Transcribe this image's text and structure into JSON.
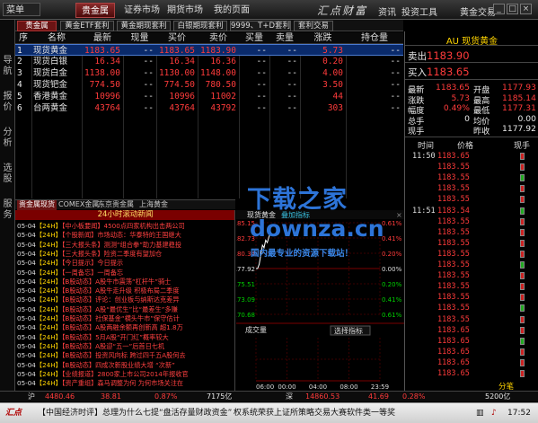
{
  "topbar": {
    "menu_label": "菜单",
    "tabs": [
      "贵金属",
      "证券市场",
      "期货市场",
      "我的页面"
    ],
    "logo": "汇点财富",
    "right_items": [
      "资讯",
      "投资工具",
      "黄金交易"
    ],
    "window_buttons": [
      "_",
      "□",
      "×"
    ]
  },
  "sidebar": {
    "items": [
      "导航",
      "报价",
      "分析",
      "选股",
      "服务"
    ]
  },
  "subtabs": [
    "贵金属",
    "黄金ETF套利",
    "黄金期现套利",
    "白银期现套利",
    "9999、T+D套利",
    "套利交易"
  ],
  "quote_table": {
    "columns": [
      "序",
      "名称",
      "最新",
      "现量",
      "买价",
      "卖价",
      "买量",
      "卖量",
      "涨跌",
      "持仓量"
    ],
    "rows": [
      {
        "idx": "1",
        "name": "现货黄金",
        "last": "1183.65",
        "vol": "--",
        "bid": "1183.65",
        "ask": "1183.90",
        "bidvol": "--",
        "askvol": "--",
        "chg": "5.73",
        "oi": "--"
      },
      {
        "idx": "2",
        "name": "现货白银",
        "last": "16.34",
        "vol": "--",
        "bid": "16.34",
        "ask": "16.36",
        "bidvol": "--",
        "askvol": "--",
        "chg": "0.20",
        "oi": "--"
      },
      {
        "idx": "3",
        "name": "现货白金",
        "last": "1138.00",
        "vol": "--",
        "bid": "1130.00",
        "ask": "1148.00",
        "bidvol": "--",
        "askvol": "--",
        "chg": "4.00",
        "oi": "--"
      },
      {
        "idx": "4",
        "name": "现货钯金",
        "last": "774.50",
        "vol": "--",
        "bid": "774.50",
        "ask": "780.50",
        "bidvol": "--",
        "askvol": "--",
        "chg": "3.50",
        "oi": "--"
      },
      {
        "idx": "5",
        "name": "香港黄金",
        "last": "10996",
        "vol": "--",
        "bid": "10996",
        "ask": "11002",
        "bidvol": "--",
        "askvol": "--",
        "chg": "44",
        "oi": "--"
      },
      {
        "idx": "6",
        "name": "台两黄金",
        "last": "43764",
        "vol": "--",
        "bid": "43764",
        "ask": "43792",
        "bidvol": "--",
        "askvol": "--",
        "chg": "303",
        "oi": "--"
      }
    ]
  },
  "market_tabs": [
    "贵金属现货",
    "COMEX金属",
    "东京贵金属",
    "上海黄金"
  ],
  "news": {
    "title": "24小时滚动新闻",
    "items": [
      {
        "date": "05-04",
        "tag": "【24H】",
        "text": "【中小板要闻】4500点四家机构出击两公司"
      },
      {
        "date": "05-04",
        "tag": "【24H】",
        "text": "【个股新闻】市场动态：华泰特的王国继大"
      },
      {
        "date": "05-04",
        "tag": "【24H】",
        "text": "【三大报头条】测测“组合拳”助力基建稳投"
      },
      {
        "date": "05-04",
        "tag": "【24H】",
        "text": "【三大报头条】险资二季度有望加仓"
      },
      {
        "date": "05-04",
        "tag": "【24H】",
        "text": "【今日提示】今日提示"
      },
      {
        "date": "05-04",
        "tag": "【24H】",
        "text": "【一周备忘】一周备忘"
      },
      {
        "date": "05-04",
        "tag": "【24H】",
        "text": "【B股动态】A股牛市震荡“杠杆牛”骑士"
      },
      {
        "date": "05-04",
        "tag": "【24H】",
        "text": "【B股动态】A股牛走升级 积极布局二季度"
      },
      {
        "date": "05-04",
        "tag": "【24H】",
        "text": "【B股动态】评论：创业板与纳斯达克差异"
      },
      {
        "date": "05-04",
        "tag": "【24H】",
        "text": "【B股动态】A股“最优生”比“最差生”多赚"
      },
      {
        "date": "05-04",
        "tag": "【24H】",
        "text": "【B股动态】社保基金“横头牛市”保守估计"
      },
      {
        "date": "05-04",
        "tag": "【24H】",
        "text": "【B股动态】A股两融余额再创新高 超1.8万"
      },
      {
        "date": "05-04",
        "tag": "【24H】",
        "text": "【B股动态】5月A股“开门红”概率较大"
      },
      {
        "date": "05-04",
        "tag": "【24H】",
        "text": "【B股动态】A股迎“五一”后首日七机"
      },
      {
        "date": "05-04",
        "tag": "【24H】",
        "text": "【B股动态】投资风向标 跨过四千五A股何去"
      },
      {
        "date": "05-04",
        "tag": "【24H】",
        "text": "【B股动态】四成次新股业绩大增 “次新”"
      },
      {
        "date": "05-04",
        "tag": "【24H】",
        "text": "【业绩报道】2800家上市公司2014年报收官"
      },
      {
        "date": "05-04",
        "tag": "【24H】",
        "text": "【资产重组】森马调整为何 为何市场关注在"
      }
    ]
  },
  "intraday": {
    "title": "现货黄金",
    "subtitle": "叠加指标",
    "price_ticks": [
      "1185.15",
      "1182.73",
      "1180.34",
      "1177.92",
      "1175.51",
      "1173.09",
      "1170.68"
    ],
    "pct_ticks": [
      "0.61%",
      "0.41%",
      "0.20%",
      "0.00%",
      "0.20%",
      "0.41%",
      "0.61%"
    ],
    "vol_label": "成交量",
    "vol_button": "选择指标",
    "time_ticks": [
      "06:00",
      "00:00",
      "04:00",
      "08:00",
      "23:59"
    ],
    "series_points": [
      1177.92,
      1177.92,
      1178.6,
      1180.1,
      1181.6,
      1181.2,
      1182.4,
      1182.0,
      1182.9,
      1183.6,
      1183.2
    ]
  },
  "right_panel": {
    "title": "AU 现货黄金",
    "ask_label": "卖出",
    "ask_price": "1183.90",
    "bid_label": "买入",
    "bid_price": "1183.65",
    "stats": [
      {
        "label": "最新",
        "value": "1183.65",
        "label2": "开盘",
        "value2": "1177.93"
      },
      {
        "label": "涨跌",
        "value": "5.73",
        "label2": "最高",
        "value2": "1185.14"
      },
      {
        "label": "幅度",
        "value": "0.49%",
        "label2": "最低",
        "value2": "1177.31"
      },
      {
        "label": "总手",
        "value": "0",
        "label2": "均价",
        "value2": "0.00"
      },
      {
        "label": "现手",
        "value": "",
        "label2": "昨收",
        "value2": "1177.92"
      }
    ],
    "tick_headers": [
      "时间",
      "价格",
      "现手"
    ],
    "ticks": [
      {
        "time": "11:50",
        "price": "1183.65"
      },
      {
        "time": "",
        "price": "1183.55"
      },
      {
        "time": "",
        "price": "1183.55"
      },
      {
        "time": "",
        "price": "1183.55"
      },
      {
        "time": "",
        "price": "1183.55"
      },
      {
        "time": "11:51",
        "price": "1183.54"
      },
      {
        "time": "",
        "price": "1183.55"
      },
      {
        "time": "",
        "price": "1183.55"
      },
      {
        "time": "",
        "price": "1183.55"
      },
      {
        "time": "",
        "price": "1183.55"
      },
      {
        "time": "",
        "price": "1183.55"
      },
      {
        "time": "",
        "price": "1183.55"
      },
      {
        "time": "",
        "price": "1183.55"
      },
      {
        "time": "",
        "price": "1183.55"
      },
      {
        "time": "",
        "price": "1183.55"
      },
      {
        "time": "",
        "price": "1183.55"
      },
      {
        "time": "",
        "price": "1183.65"
      },
      {
        "time": "",
        "price": "1183.65"
      },
      {
        "time": "",
        "price": "1183.65"
      },
      {
        "time": "",
        "price": "1183.65"
      },
      {
        "time": "",
        "price": "1183.65"
      }
    ],
    "footer": "分笔"
  },
  "status_bar": {
    "sh_label": "沪",
    "sh_index": "4480.46",
    "sh_chg": "38.81",
    "sh_pct": "0.87%",
    "sh_amt": "7175亿",
    "sz_label": "深",
    "sz_index": "14860.53",
    "sz_chg": "41.69",
    "sz_pct": "0.28%",
    "sz_amt": "5200亿"
  },
  "ticker": {
    "logo": "汇点",
    "text": "【中国经济时评】总理为什么七提“盘活存量财政资金”",
    "text2": "权系统荣获上证所策略交易大赛软件类一等奖",
    "clock": "17:52"
  },
  "watermark": {
    "line1": "下载之家",
    "line2": "downza.cn",
    "line3": "国内最专业的资源下载站！"
  },
  "colors": {
    "up": "#ff3b3b",
    "down": "#00d000",
    "highlight": "#ffd400",
    "selected_row": "#0a2a6a",
    "active_tab": "#6b1414"
  }
}
